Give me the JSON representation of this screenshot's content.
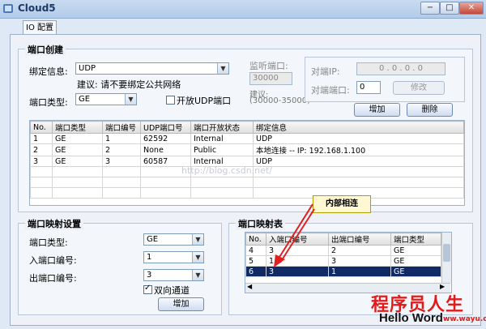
{
  "window": {
    "title": "Cloud5",
    "minimize": "−",
    "maximize": "□",
    "close": "✕"
  },
  "tab": {
    "label": "IO 配置"
  },
  "port_create": {
    "title": "端口创建",
    "bind_info_label": "绑定信息:",
    "bind_info_value": "UDP",
    "suggest_text": "建议: 请不要绑定公共网络",
    "port_type_label": "端口类型:",
    "port_type_value": "GE",
    "open_udp_label": "开放UDP端口",
    "open_udp_checked": false,
    "listen_port_label": "监听端口:",
    "listen_port_value": "30000",
    "suggest_label": "建议:",
    "suggest_range": "(30000-35000)",
    "peer_ip_label": "对端IP:",
    "peer_ip_value": "0 . 0 . 0 . 0",
    "peer_port_label": "对端端口:",
    "peer_port_value": "0",
    "modify_label": "修改",
    "add_label": "增加",
    "delete_label": "删除",
    "columns": [
      "No.",
      "端口类型",
      "端口编号",
      "UDP端口号",
      "端口开放状态",
      "绑定信息"
    ],
    "rows": [
      [
        "1",
        "GE",
        "1",
        "62592",
        "Internal",
        "UDP"
      ],
      [
        "2",
        "GE",
        "2",
        "None",
        "Public",
        "本地连接 -- IP: 192.168.1.100"
      ],
      [
        "3",
        "GE",
        "3",
        "60587",
        "Internal",
        "UDP"
      ]
    ]
  },
  "watermark": "http://blog.csdn.net/",
  "mapping_settings": {
    "title": "端口映射设置",
    "port_type_label": "端口类型:",
    "port_type_value": "GE",
    "in_port_label": "入端口编号:",
    "in_port_value": "1",
    "out_port_label": "出端口编号:",
    "out_port_value": "3",
    "bidirectional_label": "双向通道",
    "bidirectional_checked": true,
    "add_label": "增加"
  },
  "mapping_table": {
    "title": "端口映射表",
    "columns": [
      "No.",
      "入端口编号",
      "出端口编号",
      "端口类型"
    ],
    "rows": [
      [
        "4",
        "3",
        "2",
        "GE"
      ],
      [
        "5",
        "1",
        "3",
        "GE"
      ],
      [
        "6",
        "3",
        "1",
        "GE"
      ]
    ],
    "selected_row": 2
  },
  "callout": {
    "text": "内部相连"
  },
  "branding": {
    "cn": "程序员人生",
    "en": "Hello Word",
    "url": "ww.wayu.cn"
  }
}
